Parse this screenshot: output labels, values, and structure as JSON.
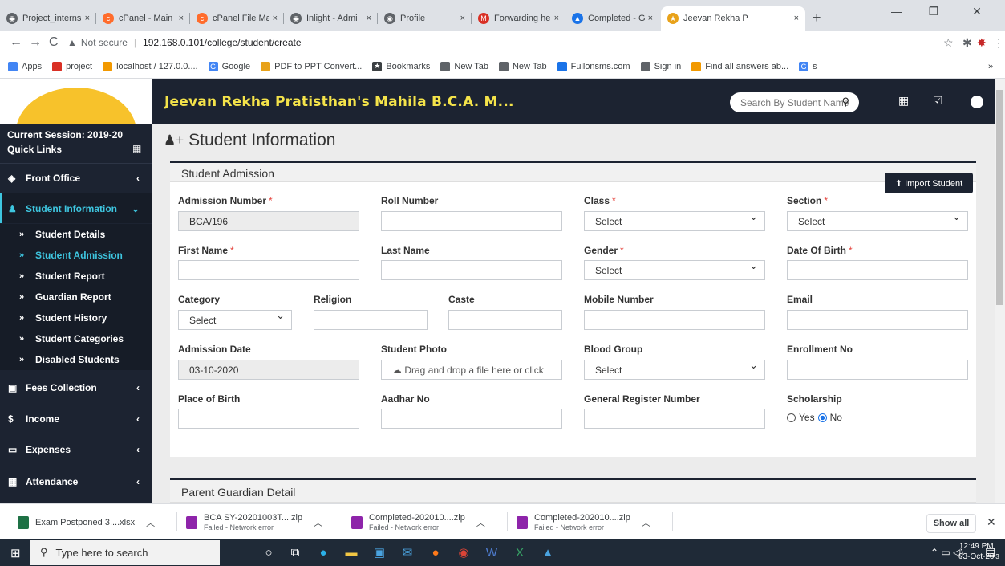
{
  "browser": {
    "tabs": [
      {
        "label": "Project_interns",
        "close": "×",
        "icon_color": "#5f6368"
      },
      {
        "label": "cPanel - Main",
        "close": "×",
        "icon_color": "#ff6c2c"
      },
      {
        "label": "cPanel File Ma",
        "close": "×",
        "icon_color": "#ff6c2c"
      },
      {
        "label": "Inlight - Admi",
        "close": "×",
        "icon_color": "#5f6368"
      },
      {
        "label": "Profile",
        "close": "×",
        "icon_color": "#5f6368"
      },
      {
        "label": "Forwarding he",
        "close": "×",
        "icon_color": "#d93025"
      },
      {
        "label": "Completed - G",
        "close": "×",
        "icon_color": "#1a73e8"
      },
      {
        "label": "Jeevan Rekha P",
        "close": "×",
        "icon_color": "#e8a21a"
      }
    ],
    "new_tab": "+",
    "omnibox": {
      "security_label": "Not secure",
      "url": "192.168.0.101/college/student/create"
    },
    "bookmarks": [
      {
        "label": "Apps",
        "icon_color": "#4285f4"
      },
      {
        "label": "project",
        "icon_color": "#d93025"
      },
      {
        "label": "localhost / 127.0.0....",
        "icon_color": "#f29900"
      },
      {
        "label": "Google",
        "icon_color": "#4285f4"
      },
      {
        "label": "PDF to PPT Convert...",
        "icon_color": "#e8a21a"
      },
      {
        "label": "Bookmarks",
        "icon_color": "#3c4043"
      },
      {
        "label": "New Tab",
        "icon_color": "#5f6368"
      },
      {
        "label": "New Tab",
        "icon_color": "#5f6368"
      },
      {
        "label": "Fullonsms.com",
        "icon_color": "#1a73e8"
      },
      {
        "label": "Sign in",
        "icon_color": "#5f6368"
      },
      {
        "label": "Find all answers ab...",
        "icon_color": "#f29900"
      },
      {
        "label": "s",
        "icon_color": "#4285f4"
      }
    ],
    "bookmarks_more": "»"
  },
  "app": {
    "title": "Jeevan Rekha Pratisthan's Mahila B.C.A. M...",
    "search_placeholder": "Search By Student Name",
    "accent": "#3ec6e0",
    "dark": "#1c2331"
  },
  "sidebar": {
    "session": "Current Session: 2019-20",
    "quick_links": "Quick Links",
    "menu": [
      {
        "label": "Front Office",
        "icon": "front-office-icon"
      },
      {
        "label": "Student Information",
        "icon": "user-plus-icon"
      },
      {
        "label": "Fees Collection",
        "icon": "money-icon"
      },
      {
        "label": "Income",
        "icon": "dollar-icon"
      },
      {
        "label": "Expenses",
        "icon": "credit-card-icon"
      },
      {
        "label": "Attendance",
        "icon": "calendar-check-icon"
      }
    ],
    "submenu": [
      {
        "label": "Student Details"
      },
      {
        "label": "Student Admission"
      },
      {
        "label": "Student Report"
      },
      {
        "label": "Guardian Report"
      },
      {
        "label": "Student History"
      },
      {
        "label": "Student Categories"
      },
      {
        "label": "Disabled Students"
      }
    ]
  },
  "main": {
    "page_title": "Student Information",
    "box_title": "Student Admission",
    "import_button": "Import Student",
    "parent_box_title": "Parent Guardian Detail",
    "fields": {
      "admission_number": {
        "label": "Admission Number",
        "value": "BCA/196"
      },
      "roll_number": {
        "label": "Roll Number",
        "value": ""
      },
      "class": {
        "label": "Class",
        "value": "Select"
      },
      "section": {
        "label": "Section",
        "value": "Select"
      },
      "first_name": {
        "label": "First Name",
        "value": ""
      },
      "last_name": {
        "label": "Last Name",
        "value": ""
      },
      "gender": {
        "label": "Gender",
        "value": "Select"
      },
      "date_of_birth": {
        "label": "Date Of Birth",
        "value": ""
      },
      "category": {
        "label": "Category",
        "value": "Select"
      },
      "religion": {
        "label": "Religion",
        "value": ""
      },
      "caste": {
        "label": "Caste",
        "value": ""
      },
      "mobile_number": {
        "label": "Mobile Number",
        "value": ""
      },
      "email": {
        "label": "Email",
        "value": ""
      },
      "admission_date": {
        "label": "Admission Date",
        "value": "03-10-2020"
      },
      "student_photo": {
        "label": "Student Photo",
        "value": "Drag and drop a file here or click"
      },
      "blood_group": {
        "label": "Blood Group",
        "value": "Select"
      },
      "enrollment_no": {
        "label": "Enrollment No",
        "value": ""
      },
      "place_of_birth": {
        "label": "Place of Birth",
        "value": ""
      },
      "aadhar_no": {
        "label": "Aadhar No",
        "value": ""
      },
      "general_register_number": {
        "label": "General Register Number",
        "value": ""
      },
      "scholarship": {
        "label": "Scholarship",
        "yes": "Yes",
        "no": "No",
        "selected": "No"
      }
    }
  },
  "downloads": {
    "items": [
      {
        "name": "Exam Postponed 3....xlsx",
        "status": ""
      },
      {
        "name": "BCA SY-20201003T....zip",
        "status": "Failed - Network error"
      },
      {
        "name": "Completed-202010....zip",
        "status": "Failed - Network error"
      },
      {
        "name": "Completed-202010....zip",
        "status": "Failed - Network error"
      }
    ],
    "show_all": "Show all"
  },
  "taskbar": {
    "search_placeholder": "Type here to search",
    "time": "12:49 PM",
    "date": "03-Oct-20",
    "notifications": "3"
  }
}
